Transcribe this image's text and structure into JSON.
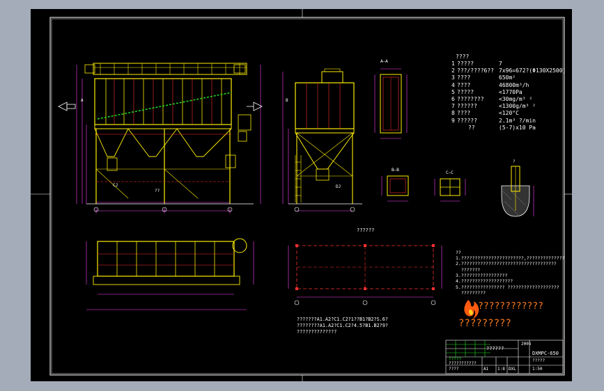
{
  "spec_table": {
    "header": "????",
    "rows": [
      {
        "no": "1",
        "label": "?????",
        "value": "7"
      },
      {
        "no": "2",
        "label": "???/????6??",
        "value": "7x96=672?(Φ130X2500)"
      },
      {
        "no": "3",
        "label": "????",
        "value": "650m²"
      },
      {
        "no": "4",
        "label": "????",
        "value": "46800m³/h"
      },
      {
        "no": "5",
        "label": "?????",
        "value": "<1770Pa"
      },
      {
        "no": "6",
        "label": "????????",
        "value": "<30mg/m³ ²"
      },
      {
        "no": "7",
        "label": "??????",
        "value": "<1300g/m³ ²"
      },
      {
        "no": "8",
        "label": "????",
        "value": "<120°C"
      },
      {
        "no": "9",
        "label": "??????",
        "value": "2.1m³ ?/min"
      },
      {
        "no": "",
        "label": "??",
        "value": "(5-7)x10 Pa"
      }
    ]
  },
  "foundation_title": "??????",
  "labels": {
    "a_a": "A—A",
    "b_b": "B—B",
    "c_c": "C—C",
    "detail": "?",
    "section_front_a": "A",
    "section_side_b": "B",
    "fan": "??",
    "hopper_left": "CJ",
    "hopper_right": "DJ"
  },
  "notes": {
    "title": "??",
    "lines": [
      "1.???????????????????????,??????????????",
      "2.???????????????????????????????????",
      "  ???????",
      "3.?????????????????",
      "4.???????????????????",
      "5.???????????????? ???????????????????",
      "  ?????????"
    ]
  },
  "bottom_notes": [
    "???????A1.A2?C1.C2?1??B1?B2?S.6?",
    "????????A1.A2?C1.C2?4.5?B1.B2?9?",
    "??????????????"
  ],
  "logo": {
    "line1": "????????????",
    "line2": "?????????"
  },
  "title_block": {
    "project": "??????",
    "drawing_no": "DXMPC-650",
    "label_a": "?????",
    "label_b": "???????????",
    "label_c": "????",
    "scale": "1:50",
    "sheet_a": "A1",
    "sheet_b": "1:8",
    "sheet_c": "DXL",
    "date": "2005",
    "extra": "?????"
  },
  "colors": {
    "frame": "#ffffff",
    "structure": "#ffee00",
    "red": "#ff3030",
    "dims": "#ff44ff",
    "green": "#22dd22",
    "cyan": "#22dddd",
    "logo": "#ff6a10"
  }
}
